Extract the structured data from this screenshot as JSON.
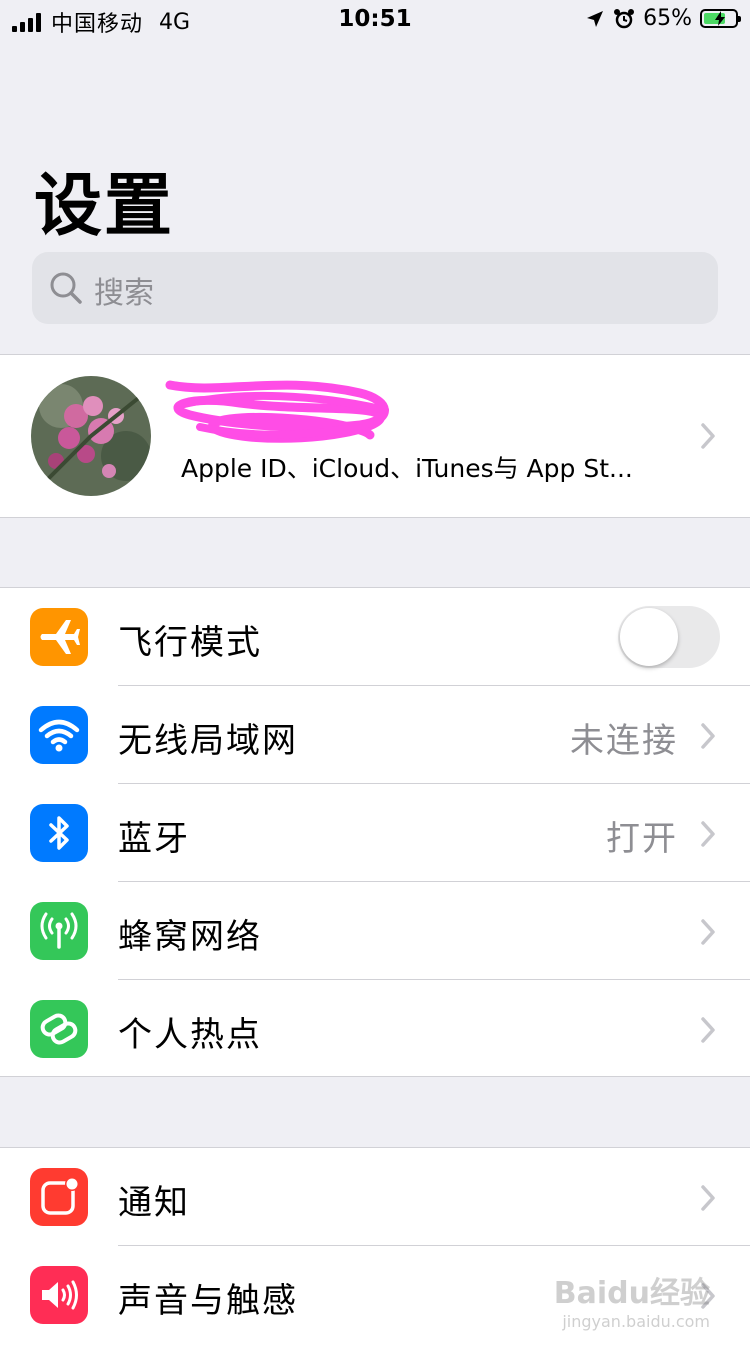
{
  "status_bar": {
    "carrier": "中国移动",
    "network": "4G",
    "time": "10:51",
    "battery_percent": "65%",
    "battery_level": 0.65
  },
  "page_title": "设置",
  "search": {
    "placeholder": "搜索"
  },
  "profile": {
    "subtitle": "Apple ID、iCloud、iTunes与 App St..."
  },
  "sections": [
    {
      "rows": [
        {
          "label": "飞行模式",
          "icon": "airplane-icon",
          "color": "#ff9500",
          "toggle": false
        },
        {
          "label": "无线局域网",
          "icon": "wifi-icon",
          "color": "#007aff",
          "value": "未连接"
        },
        {
          "label": "蓝牙",
          "icon": "bluetooth-icon",
          "color": "#007aff",
          "value": "打开"
        },
        {
          "label": "蜂窝网络",
          "icon": "cellular-antenna-icon",
          "color": "#34c759"
        },
        {
          "label": "个人热点",
          "icon": "hotspot-link-icon",
          "color": "#34c759"
        }
      ]
    },
    {
      "rows": [
        {
          "label": "通知",
          "icon": "notifications-icon",
          "color": "#ff3b30"
        },
        {
          "label": "声音与触感",
          "icon": "speaker-icon",
          "color": "#ff2d55"
        }
      ]
    }
  ],
  "watermark": {
    "brand": "Baidu经验",
    "url": "jingyan.baidu.com"
  }
}
